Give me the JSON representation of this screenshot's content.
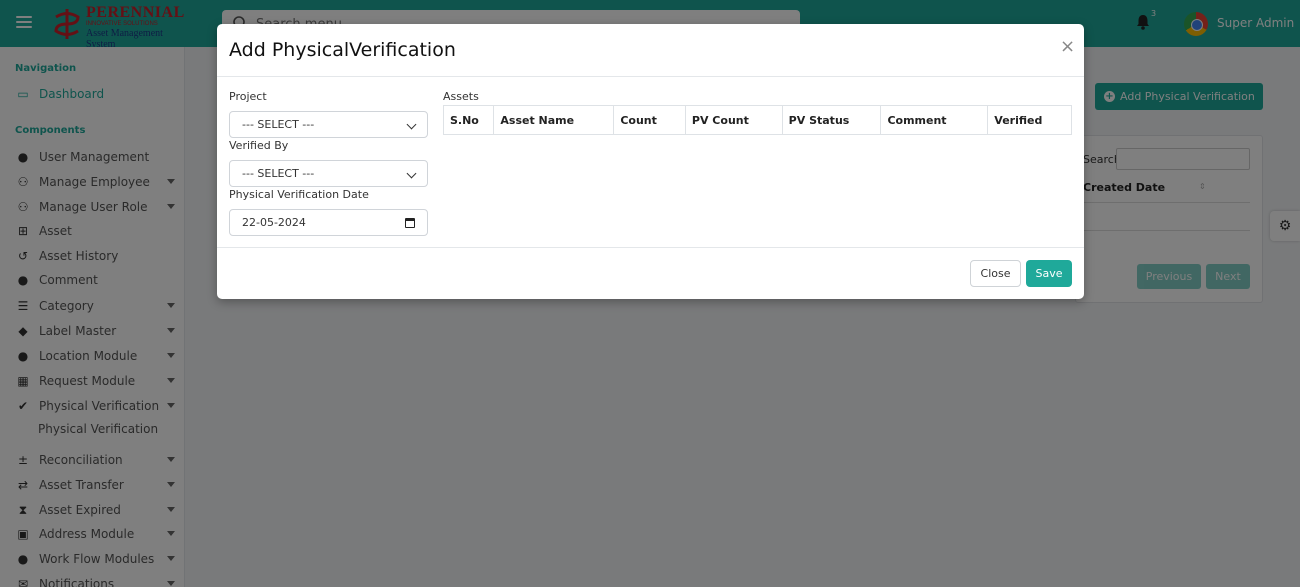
{
  "app": {
    "brand_line1": "PERENNIAL",
    "brand_line2": "INNOVATIVE SOLUTIONS",
    "brand_line3": "Asset Management System",
    "search_placeholder": "Search menu",
    "notification_count": "3",
    "user_name": "Super Admin"
  },
  "sidebar": {
    "navigation_heading": "Navigation",
    "components_heading": "Components",
    "items": [
      {
        "label": "Dashboard",
        "icon": "monitor-icon"
      },
      {
        "label": "User Management",
        "icon": "user-circle-icon"
      },
      {
        "label": "Manage Employee",
        "icon": "users-icon"
      },
      {
        "label": "Manage User Role",
        "icon": "users-icon"
      },
      {
        "label": "Asset",
        "icon": "grid-icon"
      },
      {
        "label": "Asset History",
        "icon": "history-icon"
      },
      {
        "label": "Comment",
        "icon": "comment-icon"
      },
      {
        "label": "Category",
        "icon": "list-icon"
      },
      {
        "label": "Label Master",
        "icon": "tag-icon"
      },
      {
        "label": "Location Module",
        "icon": "map-pin-icon"
      },
      {
        "label": "Request Module",
        "icon": "table-icon"
      },
      {
        "label": "Physical Verification",
        "icon": "check-circle-icon"
      },
      {
        "label": "Reconciliation",
        "icon": "plus-minus-icon"
      },
      {
        "label": "Asset Transfer",
        "icon": "exchange-icon"
      },
      {
        "label": "Asset Expired",
        "icon": "hourglass-icon"
      },
      {
        "label": "Address Module",
        "icon": "id-card-icon"
      },
      {
        "label": "Work Flow Modules",
        "icon": "map-pin-icon"
      },
      {
        "label": "Notifications",
        "icon": "envelope-icon"
      }
    ],
    "sub_item": "Physical Verification"
  },
  "page": {
    "add_button": "Add Physical Verification",
    "search_label": "Search:",
    "column_created_date": "Created Date",
    "previous": "Previous",
    "next": "Next"
  },
  "modal": {
    "title": "Add PhysicalVerification",
    "project_label": "Project",
    "project_value": "--- SELECT ---",
    "verified_by_label": "Verified By",
    "verified_by_value": "--- SELECT ---",
    "date_label": "Physical Verification Date",
    "date_value": "22-05-2024",
    "assets_label": "Assets",
    "assets_columns": [
      "S.No",
      "Asset Name",
      "Count",
      "PV Count",
      "PV Status",
      "Comment",
      "Verified"
    ],
    "close_button": "Close",
    "save_button": "Save"
  },
  "colors": {
    "accent": "#1fa99a",
    "brand_red": "#c8202b"
  }
}
